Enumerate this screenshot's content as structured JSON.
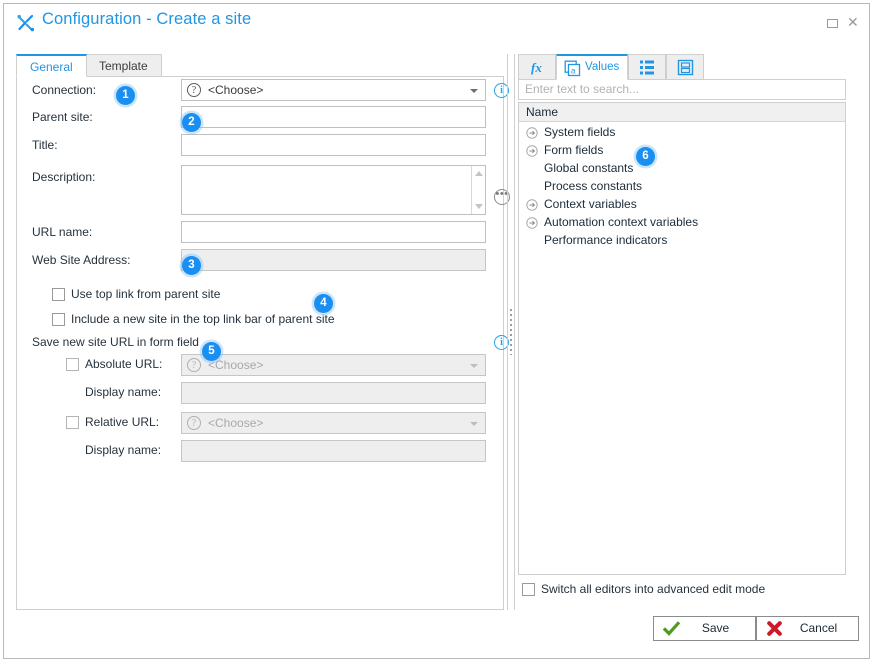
{
  "window": {
    "title": "Configuration - Create a site",
    "title_icon": "tools-icon",
    "maximize_label": "Maximize",
    "close_label": "Close"
  },
  "left_panel": {
    "tabs": [
      {
        "label": "General",
        "active": true
      },
      {
        "label": "Template",
        "active": false
      }
    ],
    "fields": {
      "connection": {
        "label": "Connection:",
        "value": "<Choose>",
        "icon": "question-mark-icon",
        "info_icon": "info-icon"
      },
      "parent_site": {
        "label": "Parent site:",
        "value": "",
        "browse_icon": "ellipsis-icon"
      },
      "title": {
        "label": "Title:",
        "value": ""
      },
      "description": {
        "label": "Description:",
        "value": ""
      },
      "url_name": {
        "label": "URL name:",
        "value": ""
      },
      "web_site_address": {
        "label": "Web Site Address:",
        "value": ""
      }
    },
    "checkboxes": {
      "use_top_link": {
        "label": "Use top link from parent site",
        "checked": false
      },
      "include_new_site": {
        "label": "Include a new site in the top link bar of parent site",
        "checked": false
      }
    },
    "save_url_section": {
      "label": "Save new site URL in form field",
      "info_icon": "info-icon",
      "absolute_url": {
        "label": "Absolute URL:",
        "checked": false,
        "value": "<Choose>",
        "disabled": true
      },
      "absolute_display_name": {
        "label": "Display name:",
        "value": "",
        "disabled": true
      },
      "relative_url": {
        "label": "Relative URL:",
        "checked": false,
        "value": "<Choose>",
        "disabled": true
      },
      "relative_display_name": {
        "label": "Display name:",
        "value": "",
        "disabled": true
      }
    }
  },
  "right_panel": {
    "tabs": [
      {
        "name": "function-tab",
        "icon": "fx-icon",
        "label": "",
        "active": false
      },
      {
        "name": "values-tab",
        "icon": "values-icon",
        "label": "Values",
        "active": true
      },
      {
        "name": "list-tab",
        "icon": "list-icon",
        "label": "",
        "active": false
      },
      {
        "name": "document-tab",
        "icon": "document-icon",
        "label": "",
        "active": false
      }
    ],
    "search": {
      "placeholder": "Enter text to search..."
    },
    "tree_header": "Name",
    "tree_items": [
      {
        "label": "System fields",
        "expandable": true
      },
      {
        "label": "Form fields",
        "expandable": true
      },
      {
        "label": "Global constants",
        "expandable": false
      },
      {
        "label": "Process constants",
        "expandable": false
      },
      {
        "label": "Context variables",
        "expandable": true
      },
      {
        "label": "Automation context variables",
        "expandable": true
      },
      {
        "label": "Performance indicators",
        "expandable": false
      }
    ],
    "advanced_mode": {
      "label": "Switch all editors into advanced edit mode",
      "checked": false
    }
  },
  "footer": {
    "save": {
      "label": "Save",
      "icon": "green-check-icon"
    },
    "cancel": {
      "label": "Cancel",
      "icon": "red-x-icon"
    }
  },
  "badges": [
    {
      "number": "1"
    },
    {
      "number": "2"
    },
    {
      "number": "3"
    },
    {
      "number": "4"
    },
    {
      "number": "5"
    },
    {
      "number": "6"
    }
  ],
  "colors": {
    "accent": "#2196e3",
    "badge": "#1b8ef2",
    "border": "#cfcfcf",
    "disabled_bg": "#eeeeee"
  }
}
